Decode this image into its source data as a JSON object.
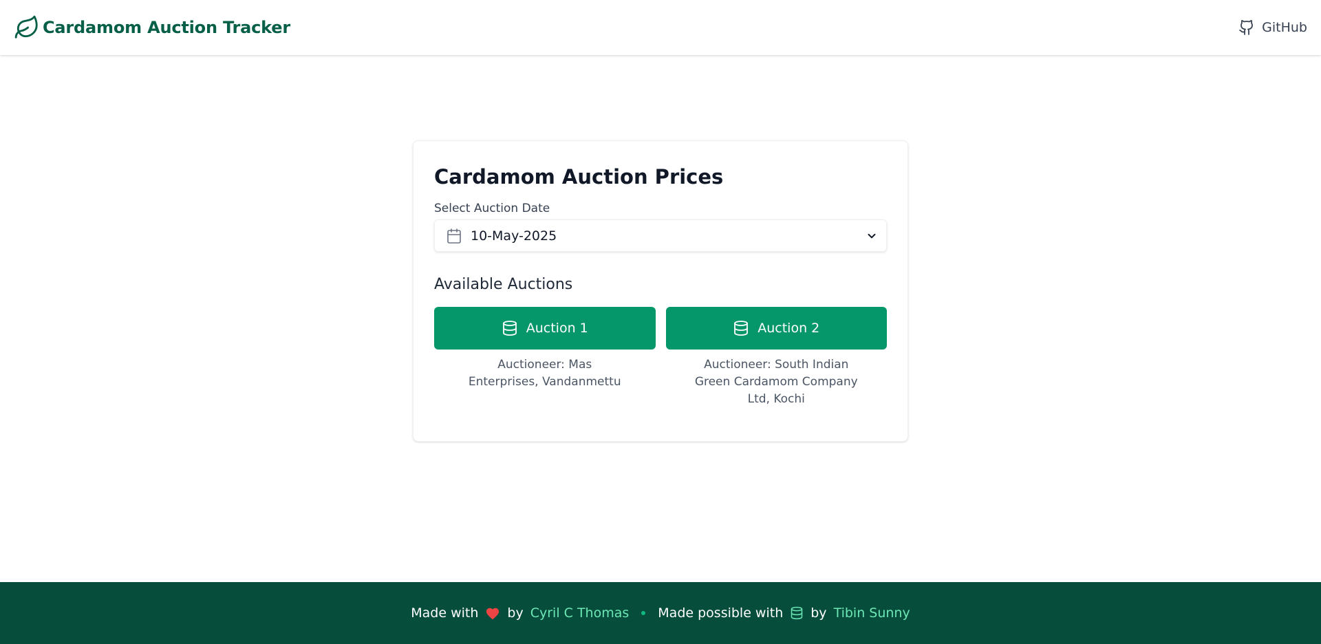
{
  "header": {
    "title": "Cardamom Auction Tracker",
    "github_label": "GitHub",
    "brand_color": "#065f46"
  },
  "card": {
    "title": "Cardamom Auction Prices",
    "date_label": "Select Auction Date",
    "selected_date": "10-May-2025",
    "section_title": "Available Auctions",
    "auctions": [
      {
        "label": "Auction 1",
        "auctioneer": "Auctioneer: Mas Enterprises, Vandanmettu",
        "icon": "database-icon"
      },
      {
        "label": "Auction 2",
        "auctioneer": "Auctioneer: South Indian Green Cardamom Company Ltd, Kochi",
        "icon": "database-icon"
      }
    ],
    "button_color": "#059669"
  },
  "footer": {
    "made_with": "Made with",
    "by_1": "by",
    "author": "Cyril C Thomas",
    "made_possible": "Made possible with",
    "by_2": "by",
    "contributor": "Tibin Sunny",
    "background": "#064e3b",
    "link_color": "#6ee7b7",
    "heart_color": "#ef4444"
  }
}
